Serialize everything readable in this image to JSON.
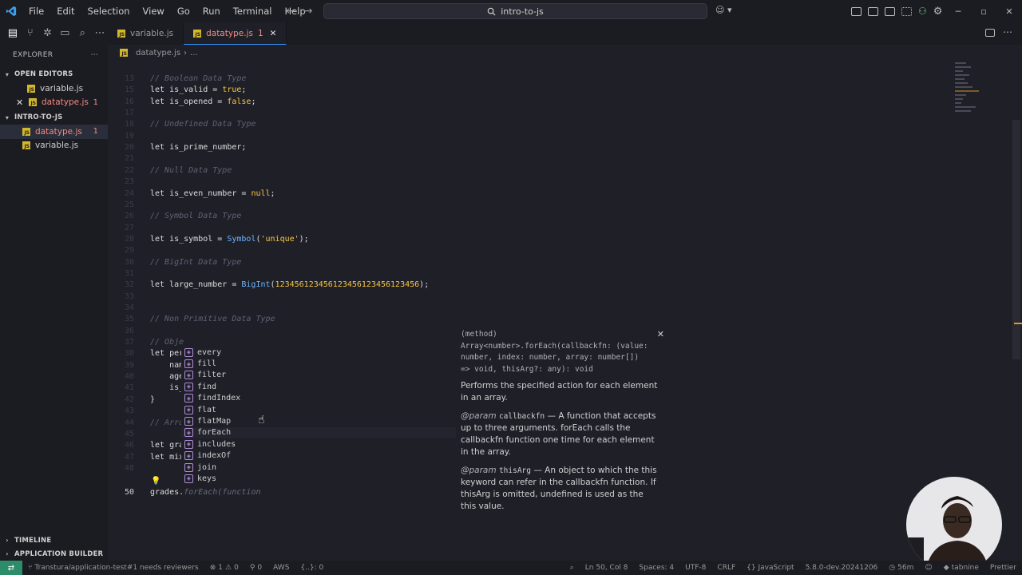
{
  "menu": [
    "File",
    "Edit",
    "Selection",
    "View",
    "Go",
    "Run",
    "Terminal",
    "Help"
  ],
  "search": {
    "text": "intro-to-js"
  },
  "sidebar": {
    "explorer_title": "EXPLORER",
    "open_editors_title": "OPEN EDITORS",
    "open_editors": [
      {
        "name": "variable.js"
      },
      {
        "name": "datatype.js",
        "badge": "1"
      }
    ],
    "folder_title": "INTRO-TO-JS",
    "files": [
      {
        "name": "datatype.js",
        "badge": "1"
      },
      {
        "name": "variable.js"
      }
    ],
    "timeline": "TIMELINE",
    "app_builder": "APPLICATION BUILDER"
  },
  "tabs": [
    {
      "name": "variable.js"
    },
    {
      "name": "datatype.js",
      "badge": "1"
    }
  ],
  "breadcrumb": [
    "datatype.js",
    "..."
  ],
  "editor": {
    "lines": [
      {
        "n": "13",
        "t": "// Boolean Data Type",
        "k": "cm"
      },
      {
        "n": "15",
        "t": "let is_valid = true;",
        "k": "bool"
      },
      {
        "n": "16",
        "t": "let is_opened = false;",
        "k": "bool"
      },
      {
        "n": "17",
        "t": "",
        "k": ""
      },
      {
        "n": "18",
        "t": "// Undefined Data Type",
        "k": "cm"
      },
      {
        "n": "19",
        "t": "",
        "k": ""
      },
      {
        "n": "20",
        "t": "let is_prime_number;",
        "k": ""
      },
      {
        "n": "21",
        "t": "",
        "k": ""
      },
      {
        "n": "22",
        "t": "// Null Data Type",
        "k": "cm"
      },
      {
        "n": "23",
        "t": "",
        "k": ""
      },
      {
        "n": "24",
        "t": "let is_even_number = null;",
        "k": "null"
      },
      {
        "n": "25",
        "t": "",
        "k": ""
      },
      {
        "n": "26",
        "t": "// Symbol Data Type",
        "k": "cm"
      },
      {
        "n": "27",
        "t": "",
        "k": ""
      },
      {
        "n": "28",
        "t": "let is_symbol = Symbol('unique');",
        "k": "sym"
      },
      {
        "n": "29",
        "t": "",
        "k": ""
      },
      {
        "n": "30",
        "t": "// BigInt Data Type",
        "k": "cm"
      },
      {
        "n": "31",
        "t": "",
        "k": ""
      },
      {
        "n": "32",
        "t": "let large_number = BigInt(123456123456123456123456123456);",
        "k": "big"
      },
      {
        "n": "33",
        "t": "",
        "k": ""
      },
      {
        "n": "34",
        "t": "",
        "k": ""
      },
      {
        "n": "35",
        "t": "// Non Primitive Data Type",
        "k": "cm"
      },
      {
        "n": "36",
        "t": "",
        "k": ""
      },
      {
        "n": "37",
        "t": "// Obje",
        "k": "cm"
      },
      {
        "n": "38",
        "t": "let per",
        "k": ""
      },
      {
        "n": "39",
        "t": "    nam",
        "k": ""
      },
      {
        "n": "40",
        "t": "    age",
        "k": ""
      },
      {
        "n": "41",
        "t": "    is_",
        "k": ""
      },
      {
        "n": "42",
        "t": "}",
        "k": "brace"
      },
      {
        "n": "43",
        "t": "",
        "k": ""
      },
      {
        "n": "44",
        "t": "// Arra",
        "k": "cm"
      },
      {
        "n": "45",
        "t": "",
        "k": ""
      },
      {
        "n": "46",
        "t": "let gra",
        "k": ""
      },
      {
        "n": "47",
        "t": "let mix",
        "k": ""
      },
      {
        "n": "48",
        "t": "",
        "k": ""
      },
      {
        "n": "50",
        "t": "grades.",
        "k": "cur",
        "ghost": "forEach(function"
      }
    ]
  },
  "suggest": {
    "items": [
      "every",
      "fill",
      "filter",
      "find",
      "findIndex",
      "flat",
      "flatMap",
      "forEach",
      "includes",
      "indexOf",
      "join",
      "keys"
    ],
    "focused": "forEach"
  },
  "details": {
    "signature": "(method) Array<number>.forEach(callbackfn: (value: number, index: number, array: number[]) => void, thisArg?: any): void",
    "description": "Performs the specified action for each element in an array.",
    "params": [
      {
        "tag": "@param",
        "name": "callbackfn",
        "text": "— A function that accepts up to three arguments. forEach calls the callbackfn function one time for each element in the array."
      },
      {
        "tag": "@param",
        "name": "thisArg",
        "text": "— An object to which the this keyword can refer in the callbackfn function. If thisArg is omitted, undefined is used as the this value."
      }
    ]
  },
  "statusbar": {
    "branch": "Transtura/application-test#1 needs reviewers",
    "problems": "1",
    "warnings": "0",
    "ports": "0",
    "aws": "AWS",
    "braces": "{..}: 0",
    "position": "Ln 50, Col 8",
    "spaces": "Spaces: 4",
    "encoding": "UTF-8",
    "eol": "CRLF",
    "language": "{} JavaScript",
    "version": "5.8.0-dev.20241206",
    "time": "56m",
    "tabnine": "tabnine",
    "prettier": "Prettier"
  },
  "colors": {
    "accent": "#3794ff",
    "error": "#f28b82",
    "remote": "#2d8c6a",
    "js_icon": "#d4b82c"
  }
}
